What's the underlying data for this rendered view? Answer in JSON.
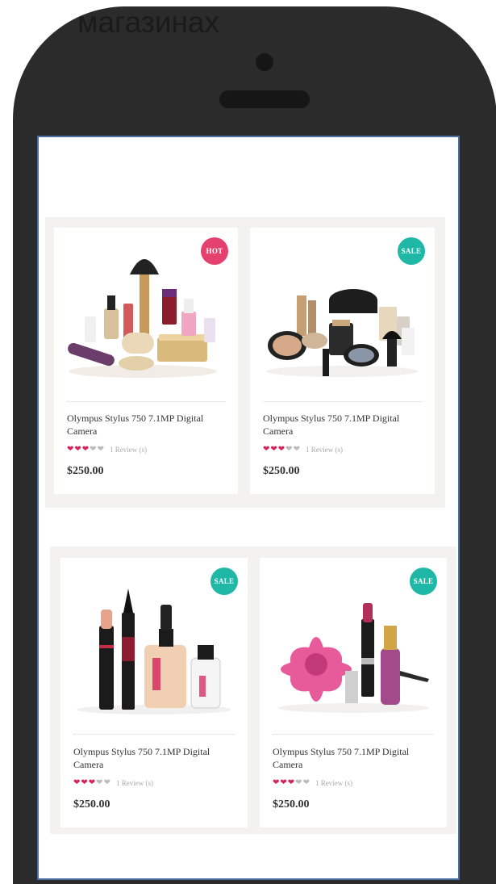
{
  "caption": "магазинах",
  "colors": {
    "hot_badge": "#e4416f",
    "sale_badge": "#1fb8a6",
    "heart_filled": "#d6245a",
    "heart_empty": "#bbbbbb"
  },
  "products": [
    {
      "badge": "HOT",
      "name": "Olympus Stylus 750 7.1MP Digital Camera",
      "rating": 3,
      "review_label": "1 Review (s)",
      "price": "$250.00",
      "image": "cosmetics-set-icon"
    },
    {
      "badge": "SALE",
      "name": "Olympus Stylus 750 7.1MP Digital Camera",
      "rating": 3,
      "review_label": "1 Review (s)",
      "price": "$250.00",
      "image": "makeup-kit-icon"
    },
    {
      "badge": "SALE",
      "name": "Olympus Stylus 750 7.1MP Digital Camera",
      "rating": 3,
      "review_label": "1 Review (s)",
      "price": "$250.00",
      "image": "lipstick-foundation-icon"
    },
    {
      "badge": "SALE",
      "name": "Olympus Stylus 750 7.1MP Digital Camera",
      "rating": 3,
      "review_label": "1 Review (s)",
      "price": "$250.00",
      "image": "flower-lipstick-icon"
    }
  ]
}
